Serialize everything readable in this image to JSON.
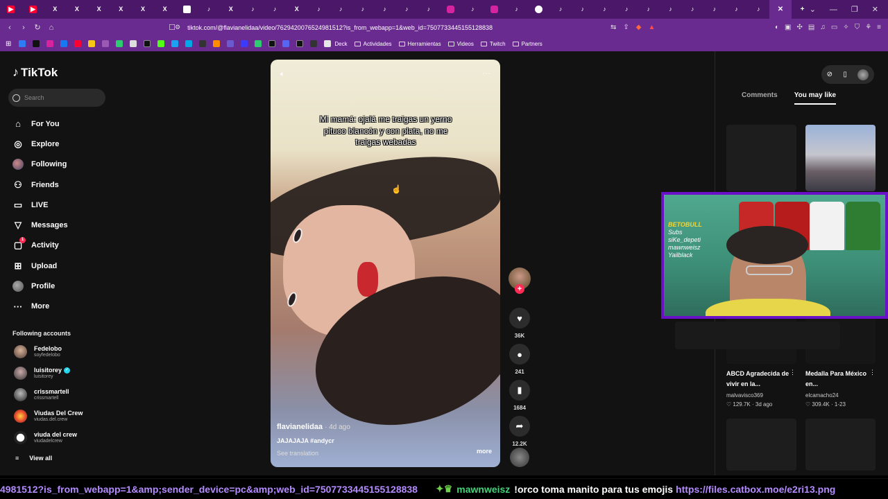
{
  "browser": {
    "tabs": [
      "yt",
      "yt",
      "x",
      "x",
      "x",
      "x",
      "x",
      "x",
      "doc",
      "tk",
      "x",
      "tk",
      "tk",
      "x",
      "tk",
      "tk",
      "tk",
      "tk",
      "tk",
      "tk",
      "ig",
      "tk",
      "ig",
      "tk",
      "gm",
      "tk",
      "tk",
      "tk",
      "tk",
      "tk",
      "tk",
      "tk",
      "tk",
      "tk",
      "tk",
      "active"
    ],
    "url": "tiktok.com/@flavianelidaa/video/7629420076524981512?is_from_webapp=1&web_id=7507733445155128838",
    "bookmarks": [
      "Deck",
      "Actividades",
      "Herramientas",
      "Videos",
      "Twitch",
      "Partners"
    ]
  },
  "sidebar": {
    "logo": "TikTok",
    "search_placeholder": "Search",
    "menu": [
      {
        "label": "For You",
        "icon": "home-icon"
      },
      {
        "label": "Explore",
        "icon": "compass-icon"
      },
      {
        "label": "Following",
        "icon": "following-avatar-icon"
      },
      {
        "label": "Friends",
        "icon": "friends-icon"
      },
      {
        "label": "LIVE",
        "icon": "live-icon"
      },
      {
        "label": "Messages",
        "icon": "messages-icon"
      },
      {
        "label": "Activity",
        "icon": "activity-icon",
        "badge": "1"
      },
      {
        "label": "Upload",
        "icon": "upload-icon"
      },
      {
        "label": "Profile",
        "icon": "profile-avatar-icon"
      },
      {
        "label": "More",
        "icon": "more-icon"
      }
    ],
    "following_title": "Following accounts",
    "accounts": [
      {
        "name": "Fedelobo",
        "handle": "soyfedelobo"
      },
      {
        "name": "luisitorey",
        "handle": "luisitorey",
        "verified": true
      },
      {
        "name": "crissmartell",
        "handle": "crissmartell"
      },
      {
        "name": "Viudas Del Crew",
        "handle": "viudas.del.crew"
      },
      {
        "name": "viuda del crew",
        "handle": "viudadelcrew"
      }
    ],
    "view_all": "View all"
  },
  "video": {
    "overlay_text": "Mi mamá: ojalá me traigas un yerno pituco blancón y con plata, no me traigas webadas",
    "username": "flavianelidaa",
    "posted": "· 4d ago",
    "description": "JAJAJAJA #andycr",
    "translate": "See translation",
    "more": "more"
  },
  "actions": {
    "likes": "36K",
    "comments": "241",
    "saves": "1684",
    "shares": "12.2K"
  },
  "right_panel": {
    "tabs": [
      "Comments",
      "You may like"
    ],
    "active_tab": "You may like",
    "cards": [
      {
        "title": "ABCD Agradecida de vivir en la...",
        "author": "malvavisco369",
        "views": "129.7K",
        "date": "3d ago"
      },
      {
        "title": "Medalla Para México en...",
        "author": "elcamacho24",
        "views": "309.4K",
        "date": "1-23"
      }
    ]
  },
  "webcam": {
    "overlay_lines": [
      "BETOBULL",
      "Subs",
      "siKe_depeti",
      "mawnweisz",
      "Yailblack"
    ]
  },
  "ticker": {
    "url_fragment": "4981512?is_from_webapp=1&amp;sender_device=pc&amp;web_id=7507733445155128838",
    "user": "mawnweisz",
    "message": "!orco toma manito para tus emojis",
    "link": "https://files.catbox.moe/e2ri13.png"
  },
  "colors": {
    "browser_purple": "#6a2b90",
    "tiktok_red": "#fe2c55",
    "cam_border": "#6a10c8",
    "chat_user": "#45d27a",
    "chat_link": "#b48bff"
  }
}
